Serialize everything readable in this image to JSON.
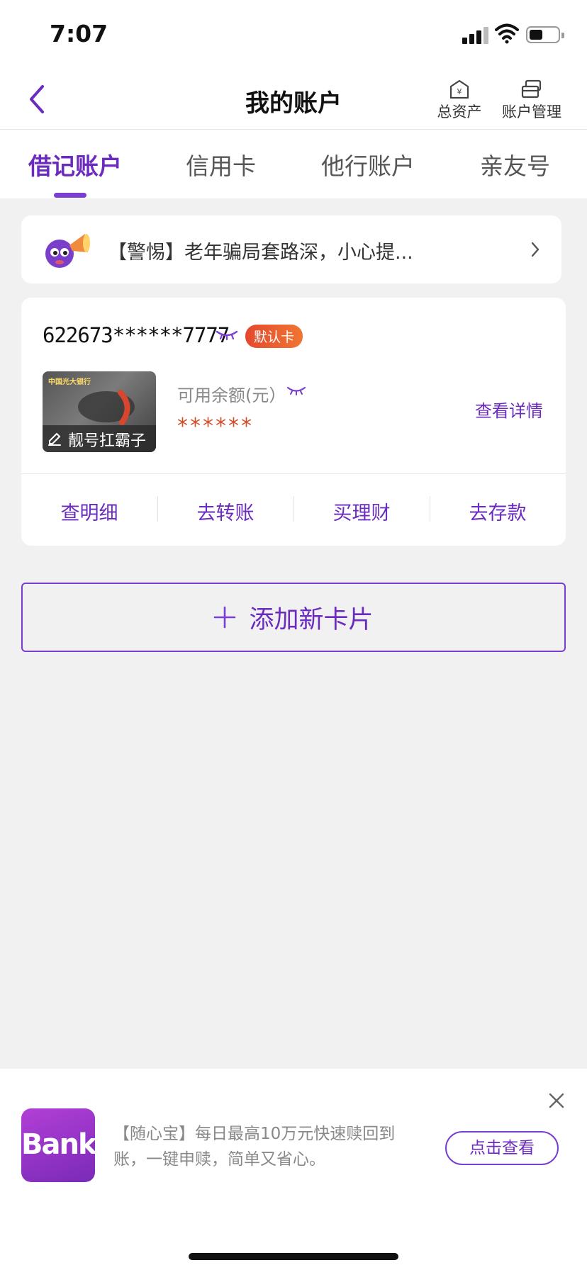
{
  "status_bar": {
    "time": "7:07"
  },
  "header": {
    "title": "我的账户",
    "actions": [
      {
        "label": "总资产",
        "icon": "asset-house-yen-icon"
      },
      {
        "label": "账户管理",
        "icon": "card-stack-icon"
      }
    ]
  },
  "tabs": [
    {
      "label": "借记账户",
      "active": true
    },
    {
      "label": "信用卡",
      "active": false
    },
    {
      "label": "他行账户",
      "active": false
    },
    {
      "label": "亲友号",
      "active": false
    }
  ],
  "notice": {
    "text": "【警惕】老年骗局套路深，小心提...",
    "icon": "megaphone-mascot-icon"
  },
  "account": {
    "number": "622673******7777",
    "default_badge": "默认卡",
    "card_label": "靓号扛霸子",
    "card_bank_name": "中国光大银行",
    "balance_label": "可用余额(元）",
    "balance_value": "******",
    "detail_link": "查看详情",
    "actions": [
      "查明细",
      "去转账",
      "买理财",
      "去存款"
    ]
  },
  "add_card": {
    "label": "添加新卡片"
  },
  "promo": {
    "logo_text": "Bank",
    "text": "【随心宝】每日最高10万元快速赎回到账，一键申赎，简单又省心。",
    "button": "点击查看"
  },
  "colors": {
    "accent": "#6c2bbf",
    "badge_gradient_start": "#e4482e",
    "badge_gradient_end": "#f07632",
    "balance_mask": "#d4502a",
    "background": "#f1f1f1"
  }
}
